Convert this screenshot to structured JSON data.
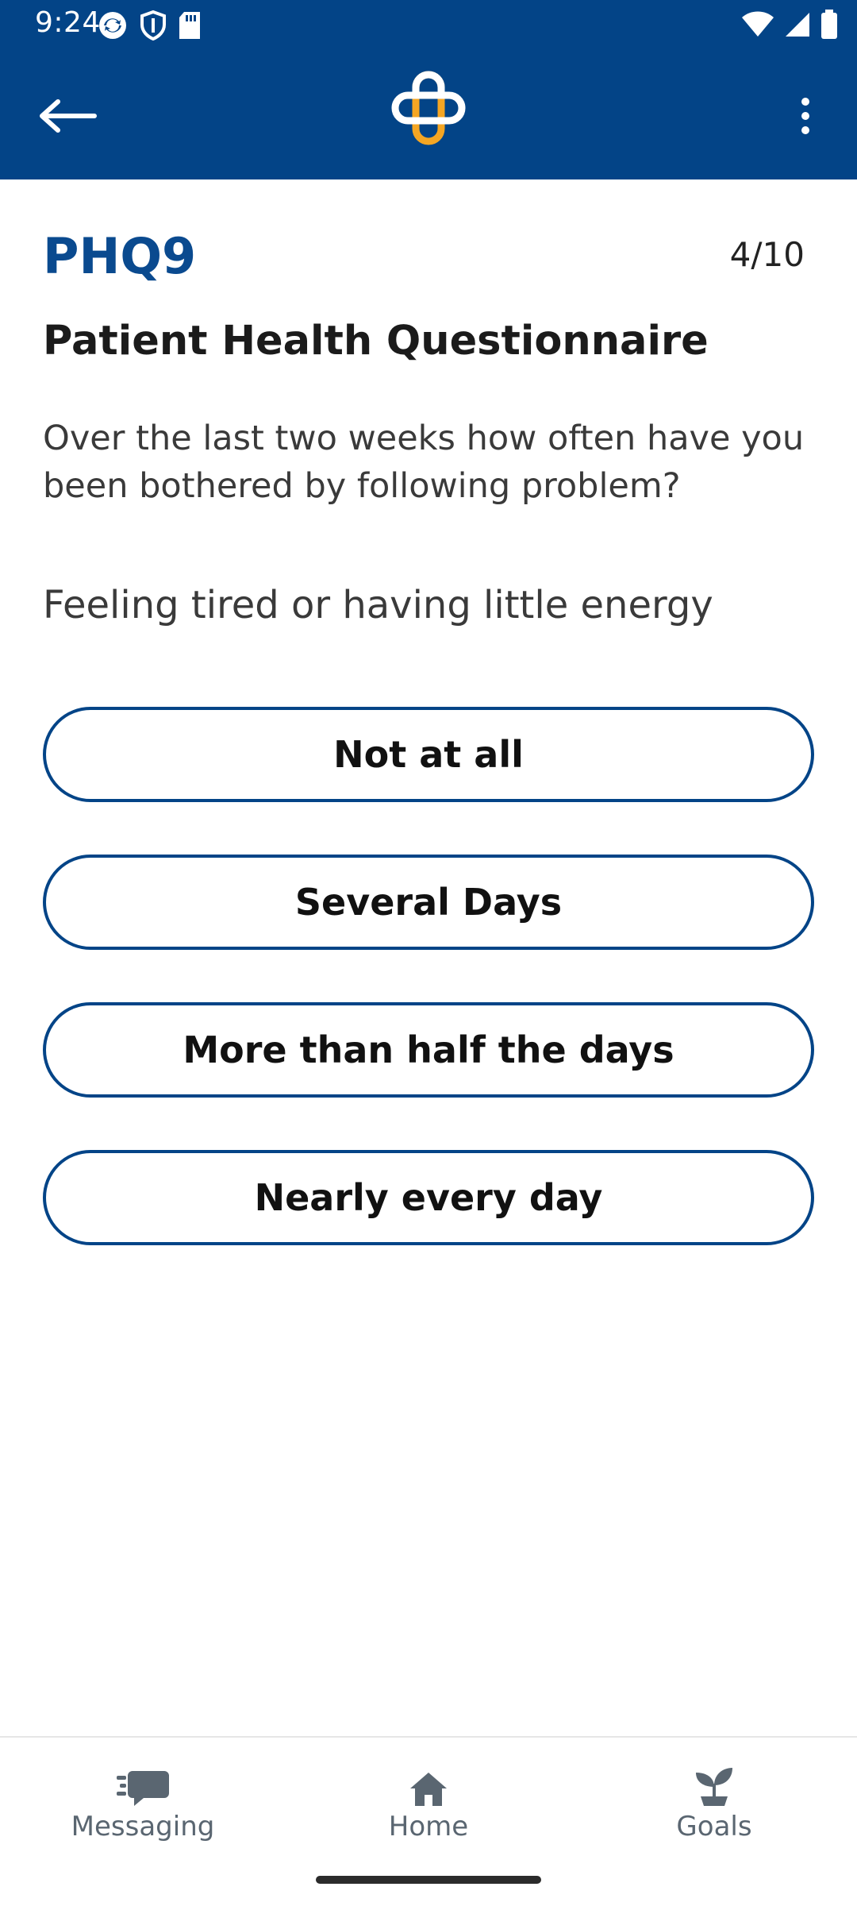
{
  "status_bar": {
    "time": "9:24",
    "icons": [
      "sync-icon",
      "shield-icon",
      "sd-card-icon",
      "wifi-icon",
      "signal-icon",
      "battery-icon"
    ]
  },
  "app_bar": {
    "background": "#034487",
    "logo_colors": {
      "outline": "#ffffff",
      "accent": "#f5a623"
    },
    "icons": [
      "back-arrow-icon",
      "app-logo",
      "more-vert-icon"
    ]
  },
  "questionnaire": {
    "code": "PHQ9",
    "progress": "4/10",
    "title": "Patient Health Questionnaire",
    "instruction": "Over the last two weeks how often have you been bothered by following problem?",
    "question": "Feeling tired or having little energy",
    "options": [
      "Not at all",
      "Several Days",
      "More than half the days",
      "Nearly every day"
    ]
  },
  "bottom_nav": {
    "items": [
      {
        "label": "Messaging",
        "icon": "chat-icon"
      },
      {
        "label": "Home",
        "icon": "home-icon"
      },
      {
        "label": "Goals",
        "icon": "sprout-icon"
      }
    ]
  },
  "colors": {
    "primary": "#034487",
    "title_blue": "#0a4a8f",
    "nav_gray": "#5a6671"
  }
}
